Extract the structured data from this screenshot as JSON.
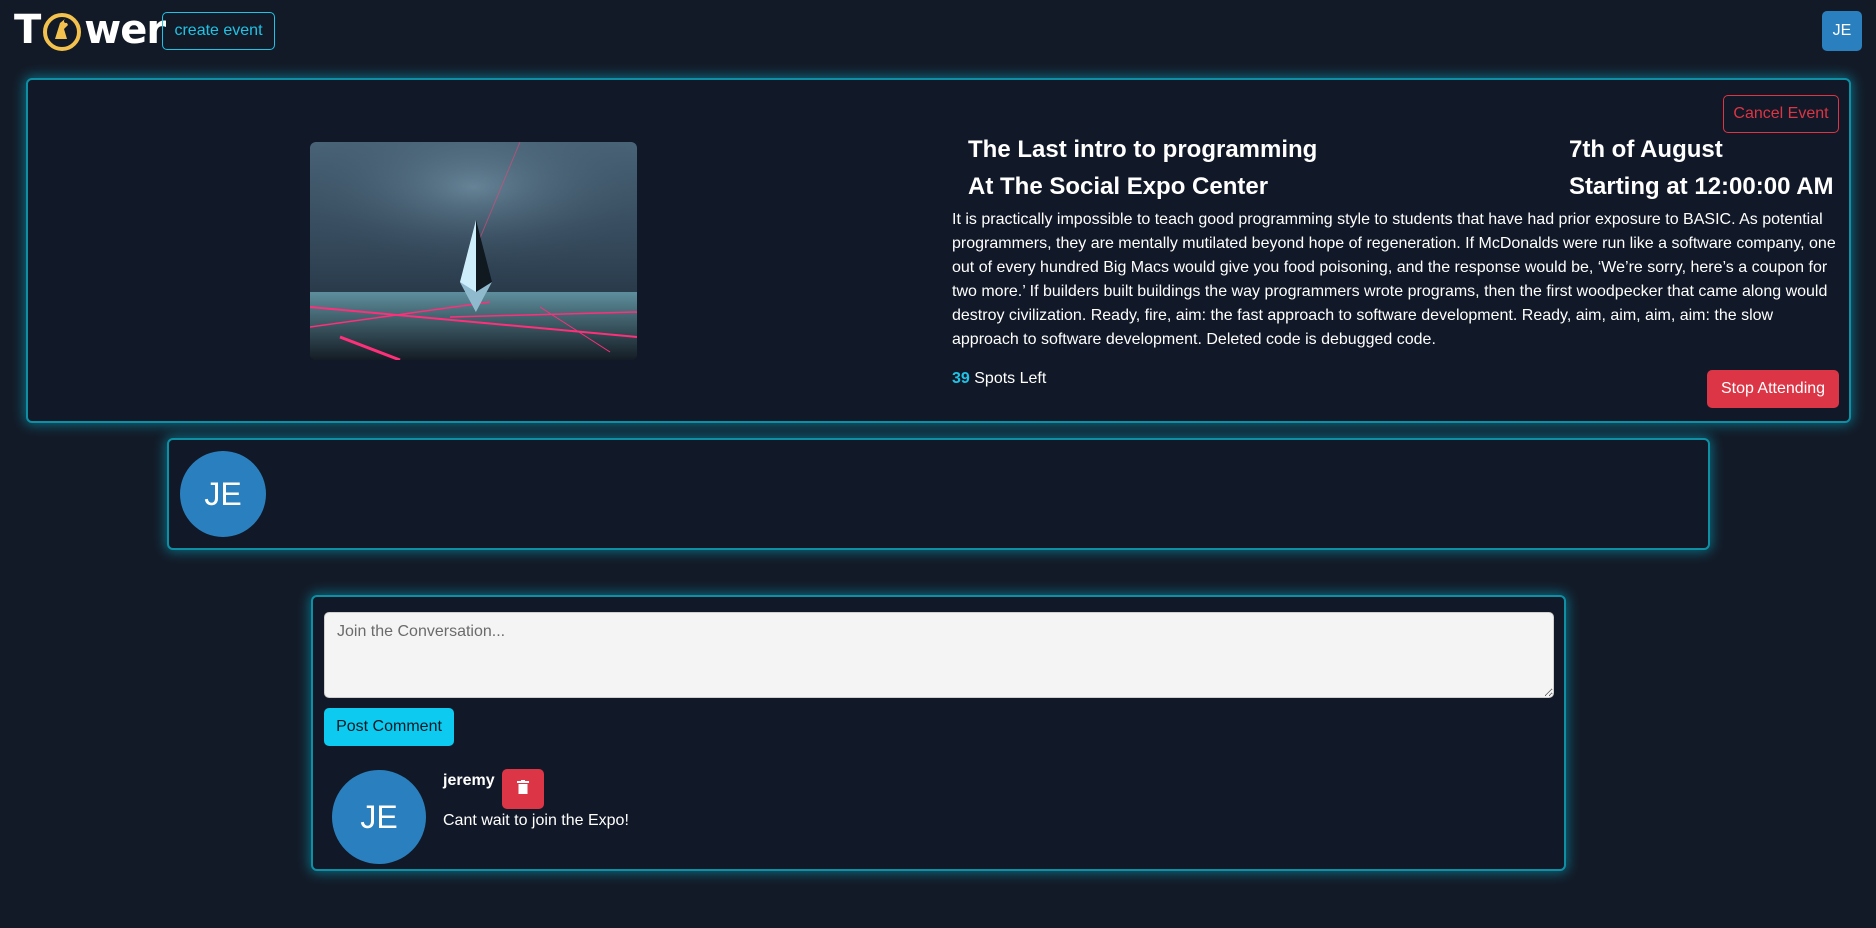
{
  "nav": {
    "logo_prefix": "T",
    "logo_suffix": "wer",
    "create_event_label": "create event",
    "user_initials": "JE"
  },
  "event": {
    "cancel_label": "Cancel Event",
    "title": "The Last intro to programming",
    "location": "At The Social Expo Center",
    "date": "7th of August",
    "start_time": "Starting at 12:00:00 AM",
    "description": "It is practically impossible to teach good programming style to students that have had prior exposure to BASIC. As potential programmers, they are mentally mutilated beyond hope of regeneration. If McDonalds were run like a software company, one out of every hundred Big Macs would give you food poisoning, and the response would be, ‘We’re sorry, here’s a coupon for two more.’ If builders built buildings the way programmers wrote programs, then the first woodpecker that came along would destroy civilization. Ready, fire, aim: the fast approach to software development. Ready, aim, aim, aim, aim: the slow approach to software development. Deleted code is debugged code.",
    "spots_count": "39",
    "spots_label": "Spots Left",
    "stop_attending_label": "Stop Attending"
  },
  "attendees": [
    {
      "initials": "JE"
    }
  ],
  "comments": {
    "input_placeholder": "Join the Conversation...",
    "post_label": "Post Comment",
    "items": [
      {
        "initials": "JE",
        "author": "jeremy",
        "body": "Cant wait to join the Expo!"
      }
    ]
  },
  "colors": {
    "background": "#131a27",
    "accent_cyan": "#1ec3e6",
    "danger": "#dc3545",
    "avatar_blue": "#2a80be"
  }
}
